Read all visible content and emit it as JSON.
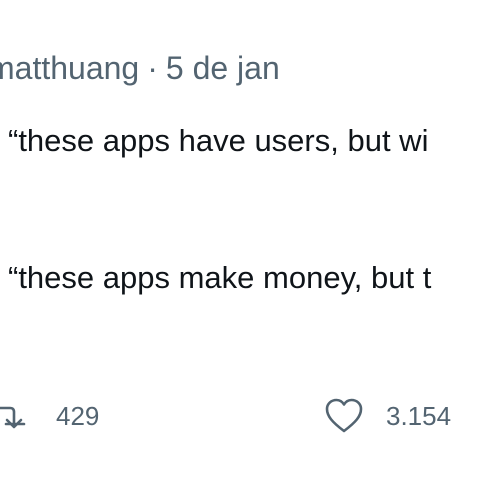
{
  "tweet": {
    "author_handle": "matthuang",
    "separator": "·",
    "date": "5 de jan",
    "lines": [
      "“these apps have users, but wi",
      "“these apps make money, but t"
    ]
  },
  "actions": {
    "retweet": {
      "icon": "retweet-icon",
      "count": "429"
    },
    "like": {
      "icon": "heart-icon",
      "count": "3.154"
    }
  },
  "colors": {
    "text_primary": "#0f1419",
    "text_secondary": "#536471",
    "background": "#ffffff"
  }
}
